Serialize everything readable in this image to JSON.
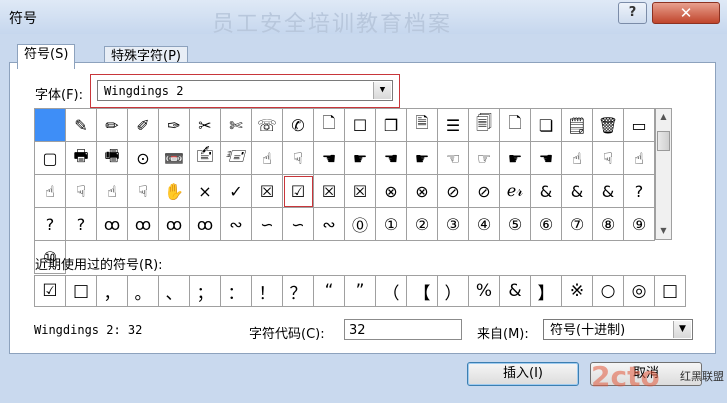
{
  "window": {
    "title": "符号",
    "watermark_title": "员工安全培训教育档案",
    "help": "?",
    "close": "✕"
  },
  "tabs": [
    {
      "label": "符号(S)"
    },
    {
      "label": "特殊字符(P)"
    }
  ],
  "font": {
    "label": "字体(F):",
    "value": "Wingdings 2"
  },
  "symbols": [
    "",
    "✎",
    "✏",
    "✐",
    "✑",
    "✂",
    "✄",
    "☏",
    "✆",
    "🗋",
    "☐",
    "❐",
    "🗎",
    "☰",
    "🗐",
    "🗋",
    "❏",
    "🗒",
    "🗑",
    "▭",
    "▢",
    "🖶",
    "🖷",
    "⊙",
    "📼",
    "🖆",
    "🖅",
    "☝",
    "☟",
    "☚",
    "☛",
    "☚",
    "☛",
    "☜",
    "☞",
    "☛",
    "☚",
    "☝",
    "☟",
    "☝",
    "☝",
    "☟",
    "☝",
    "☟",
    "✋",
    "×",
    "✓",
    "☒",
    "☑",
    "☒",
    "☒",
    "⊗",
    "⊗",
    "⊘",
    "⊘",
    "ℯ𝓇",
    "&",
    "&",
    "&",
    "?",
    "?",
    "?",
    "ꝏ",
    "ꝏ",
    "ꝏ",
    "ꝏ",
    "∾",
    "∽",
    "∽",
    "∾",
    "⓪",
    "①",
    "②",
    "③",
    "④",
    "⑤",
    "⑥",
    "⑦",
    "⑧",
    "⑨",
    "⑩"
  ],
  "recent": {
    "label": "近期使用过的符号(R):",
    "items": [
      "☑",
      "□",
      "，",
      "。",
      "、",
      "；",
      "：",
      "！",
      "？",
      "“",
      "”",
      "（",
      "【",
      "）",
      "%",
      "&",
      "】",
      "※",
      "○",
      "◎",
      "□"
    ]
  },
  "status": {
    "font_code": "Wingdings 2: 32",
    "charcode_label": "字符代码(C):",
    "charcode_value": "32",
    "from_label": "来自(M):",
    "from_value": "符号(十进制)"
  },
  "buttons": {
    "insert": "插入(I)",
    "cancel": "取消"
  },
  "watermark": {
    "logo": "2cto",
    "text": "红黑联盟"
  }
}
